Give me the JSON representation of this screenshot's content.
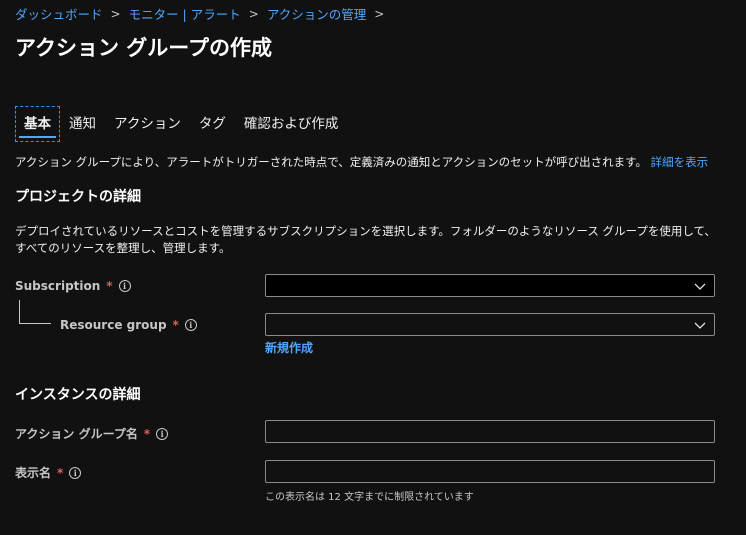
{
  "breadcrumb": {
    "items": [
      "ダッシュボード",
      "モニター | アラート",
      "アクションの管理"
    ],
    "separator": ">"
  },
  "page_title": "アクション グループの作成",
  "tabs": [
    {
      "label": "基本",
      "active": true
    },
    {
      "label": "通知",
      "active": false
    },
    {
      "label": "アクション",
      "active": false
    },
    {
      "label": "タグ",
      "active": false
    },
    {
      "label": "確認および作成",
      "active": false
    }
  ],
  "description": {
    "text": "アクション グループにより、アラートがトリガーされた時点で、定義済みの通知とアクションのセットが呼び出されます。",
    "link": "詳細を表示"
  },
  "project": {
    "title": "プロジェクトの詳細",
    "paragraph": "デプロイされているリソースとコストを管理するサブスクリプションを選択します。フォルダーのようなリソース グループを使用して、すべてのリソースを整理し、管理します。",
    "subscription_label": "Subscription",
    "subscription_value": "",
    "resource_group_label": "Resource group",
    "resource_group_value": "",
    "new_link": "新規作成"
  },
  "instance": {
    "title": "インスタンスの詳細",
    "action_group_name_label": "アクション グループ名",
    "action_group_name_value": "",
    "display_name_label": "表示名",
    "display_name_value": "",
    "display_name_hint": "この表示名は 12 文字までに制限されています"
  },
  "required_marker": "*",
  "info_glyph": "i",
  "colors": {
    "background": "#111111",
    "accent": "#4ea6ff",
    "required": "#e06060",
    "input_border": "#8a8a8a"
  }
}
